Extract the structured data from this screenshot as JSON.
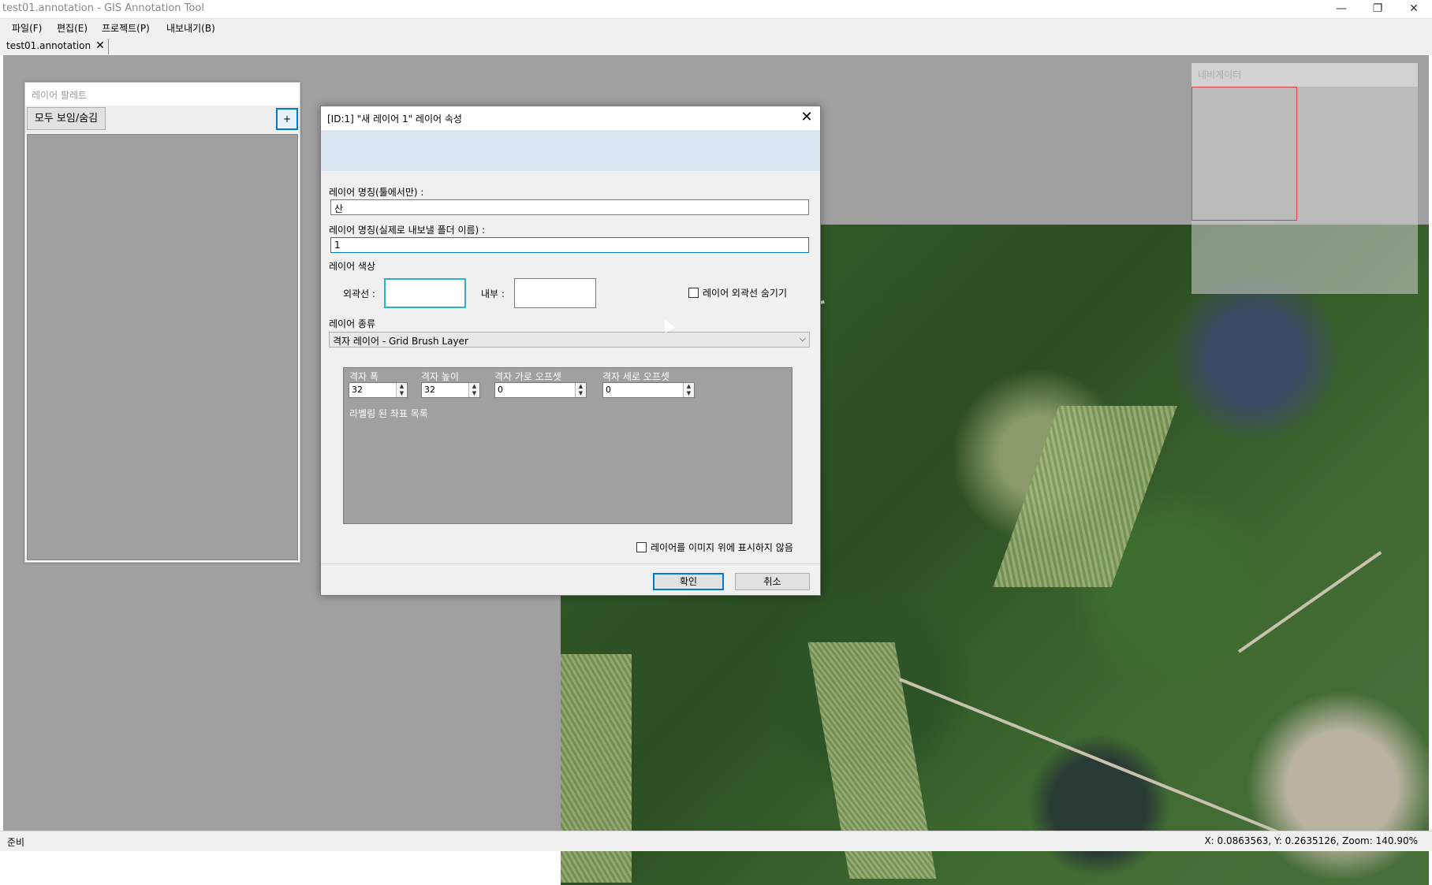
{
  "window": {
    "title": "test01.annotation - GIS Annotation Tool",
    "minimize": "—",
    "restore": "❐",
    "close": "✕"
  },
  "menu": [
    "파일(F)",
    "편집(E)",
    "프로젝트(P)",
    "내보내기(B)"
  ],
  "tab": {
    "label": "test01.annotation",
    "close": "✕"
  },
  "palette": {
    "title": "레이어 팔레트",
    "show_all_button": "모두 보임/숨김",
    "add_button": "+"
  },
  "navigator": {
    "title": "네비게이터"
  },
  "dialog": {
    "title": "[ID:1] \"새 레이어 1\" 레이어 속성",
    "close": "✕",
    "name_tool_label": "레이어 명칭(툴에서만) :",
    "name_tool_value": "산",
    "name_export_label": "레이어 명칭(실제로 내보낼 폴더 이름) :",
    "name_export_value": "1",
    "color_label": "레이어 색상",
    "outline_label": "외곽선 :",
    "inner_label": "내부 :",
    "hide_outline_label": "레이어 외곽선 숨기기",
    "type_label": "레이어 종류",
    "type_value": "격자 레이어 - Grid Brush Layer",
    "grid": {
      "width_label": "격자 폭",
      "width_value": "32",
      "height_label": "격자 높이",
      "height_value": "32",
      "xoffset_label": "격자 가로 오프셋",
      "xoffset_value": "0",
      "yoffset_label": "격자 세로 오프셋",
      "yoffset_value": "0",
      "coords_label": "라벨링 된 좌표 목록"
    },
    "no_display_label": "레이어를 이미지 위에 표시하지 않음",
    "ok_button": "확인",
    "cancel_button": "취소"
  },
  "status": {
    "left": "준비",
    "right": "X: 0.0863563, Y: 0.2635126, Zoom: 140.90%"
  }
}
